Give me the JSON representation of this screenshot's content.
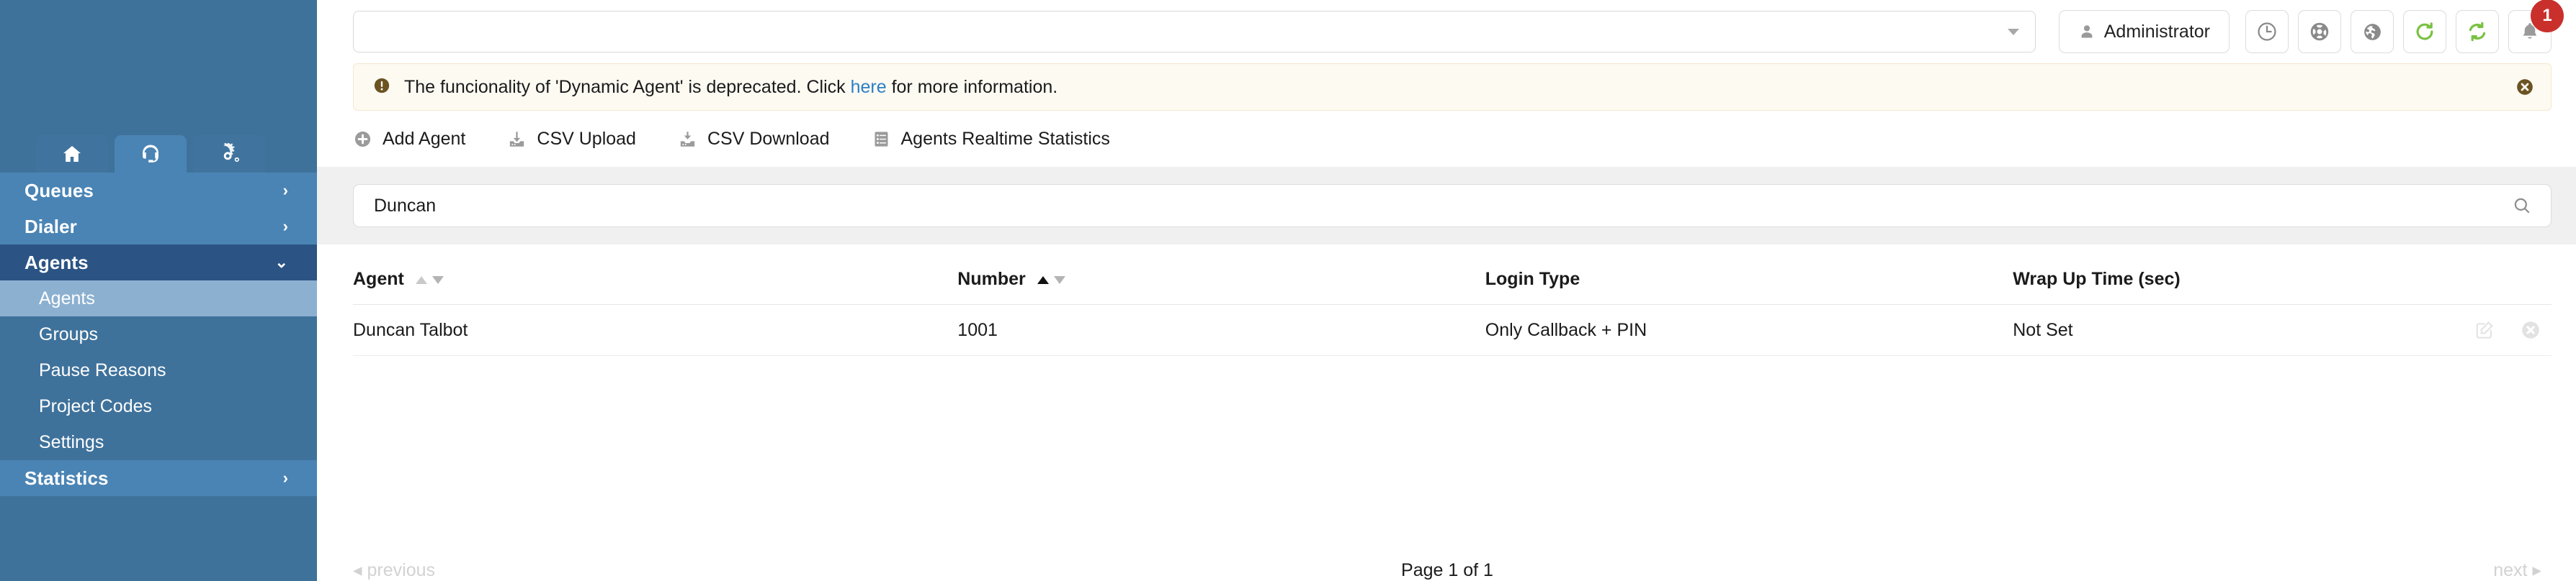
{
  "sidebar": {
    "module_tabs": [
      {
        "name": "home",
        "icon": "home-icon",
        "active": false
      },
      {
        "name": "callcenter",
        "icon": "headset-icon",
        "active": true
      },
      {
        "name": "settings",
        "icon": "gears-icon",
        "active": false
      }
    ],
    "nav": [
      {
        "label": "Queues",
        "expanded": false,
        "chevron": "›"
      },
      {
        "label": "Dialer",
        "expanded": false,
        "chevron": "›"
      },
      {
        "label": "Agents",
        "expanded": true,
        "chevron": "⌄",
        "children": [
          {
            "label": "Agents",
            "selected": true
          },
          {
            "label": "Groups",
            "selected": false
          },
          {
            "label": "Pause Reasons",
            "selected": false
          },
          {
            "label": "Project Codes",
            "selected": false
          },
          {
            "label": "Settings",
            "selected": false
          }
        ]
      },
      {
        "label": "Statistics",
        "expanded": false,
        "chevron": "›"
      }
    ]
  },
  "topbar": {
    "global_select": {
      "value": "",
      "placeholder": ""
    },
    "user_button": {
      "label": "Administrator",
      "icon": "user-icon"
    },
    "icon_buttons": [
      {
        "name": "clock-icon",
        "color": "#8a8a8a"
      },
      {
        "name": "lifebuoy-icon",
        "color": "#8a8a8a"
      },
      {
        "name": "globe-icon",
        "color": "#8a8a8a"
      },
      {
        "name": "refresh-icon",
        "color": "#7ac143"
      },
      {
        "name": "sync-icon",
        "color": "#7ac143"
      },
      {
        "name": "bell-icon",
        "color": "#9a9a9a",
        "badge": "1"
      }
    ],
    "badge_color": "#c9302c"
  },
  "alert": {
    "icon": "exclamation-circle-icon",
    "text_before": "The funcionality of 'Dynamic Agent' is deprecated. Click ",
    "link_text": "here",
    "text_after": " for more information.",
    "close_icon": "close-circle-icon",
    "background": "#fdfaf2",
    "accent": "#6b5322"
  },
  "actions": [
    {
      "label": "Add Agent",
      "icon": "plus-circle-icon"
    },
    {
      "label": "CSV Upload",
      "icon": "upload-icon"
    },
    {
      "label": "CSV Download",
      "icon": "download-icon"
    },
    {
      "label": "Agents Realtime Statistics",
      "icon": "list-report-icon"
    }
  ],
  "search": {
    "value": "Duncan",
    "placeholder": "",
    "icon": "search-icon"
  },
  "table": {
    "columns": [
      {
        "label": "Agent",
        "sortable": true,
        "sort_state": "none"
      },
      {
        "label": "Number",
        "sortable": true,
        "sort_state": "asc"
      },
      {
        "label": "Login Type",
        "sortable": false,
        "sort_state": "none"
      },
      {
        "label": "Wrap Up Time (sec)",
        "sortable": false,
        "sort_state": "none"
      },
      {
        "label": "",
        "sortable": false,
        "sort_state": "none"
      }
    ],
    "rows": [
      {
        "agent": "Duncan Talbot",
        "number": "1001",
        "login_type": "Only Callback + PIN",
        "wrap_up_time": "Not Set",
        "edit_icon": "edit-icon",
        "delete_icon": "delete-circle-icon"
      }
    ]
  },
  "pagination": {
    "previous_label": "previous",
    "next_label": "next",
    "page_info": "Page 1 of 1",
    "prev_arrow": "◂",
    "next_arrow": "▸"
  }
}
